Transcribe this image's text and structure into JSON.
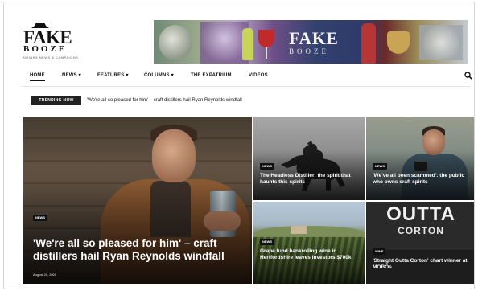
{
  "header": {
    "logo": {
      "line1": "FAKE",
      "line2": "BOOZE",
      "tagline": "DRINKS NEWS & CAMPAIGNS"
    },
    "banner": {
      "brand_line1": "FAKE",
      "brand_line2": "BOOZE"
    }
  },
  "nav": {
    "items": [
      {
        "label": "HOME",
        "active": true
      },
      {
        "label": "NEWS ▾"
      },
      {
        "label": "FEATURES ▾"
      },
      {
        "label": "COLUMNS ▾"
      },
      {
        "label": "THE EXPATRIUM"
      },
      {
        "label": "VIDEOS"
      }
    ],
    "search_icon": "search-icon"
  },
  "trending": {
    "badge": "TRENDING NOW",
    "headline": "'We're all so pleased for him' – craft distillers hail Ryan Reynolds windfall"
  },
  "tiles": {
    "main": {
      "category": "NEWS",
      "title": "'We're all so pleased for him' – craft distillers hail Ryan Reynolds windfall",
      "date": "August 20, 2020"
    },
    "horse": {
      "category": "NEWS",
      "title": "The Headless Distiller: the spirit that haunts this spirits"
    },
    "man2": {
      "category": "NEWS",
      "title": "'We've all been scammed': the public who owns craft spirits"
    },
    "vine": {
      "category": "NEWS",
      "title": "Grape fund bankrolling wine in Hertfordshire leaves investors $700k"
    },
    "outta": {
      "image_line1": "OUTTA",
      "image_line2": "CORTON",
      "category": "WINE",
      "title": "'Straight Outta Corton' chart winner at MOBOs"
    }
  },
  "colors": {
    "nav_text": "#111111",
    "badge_bg": "#222222",
    "category_bg": "#111111"
  }
}
